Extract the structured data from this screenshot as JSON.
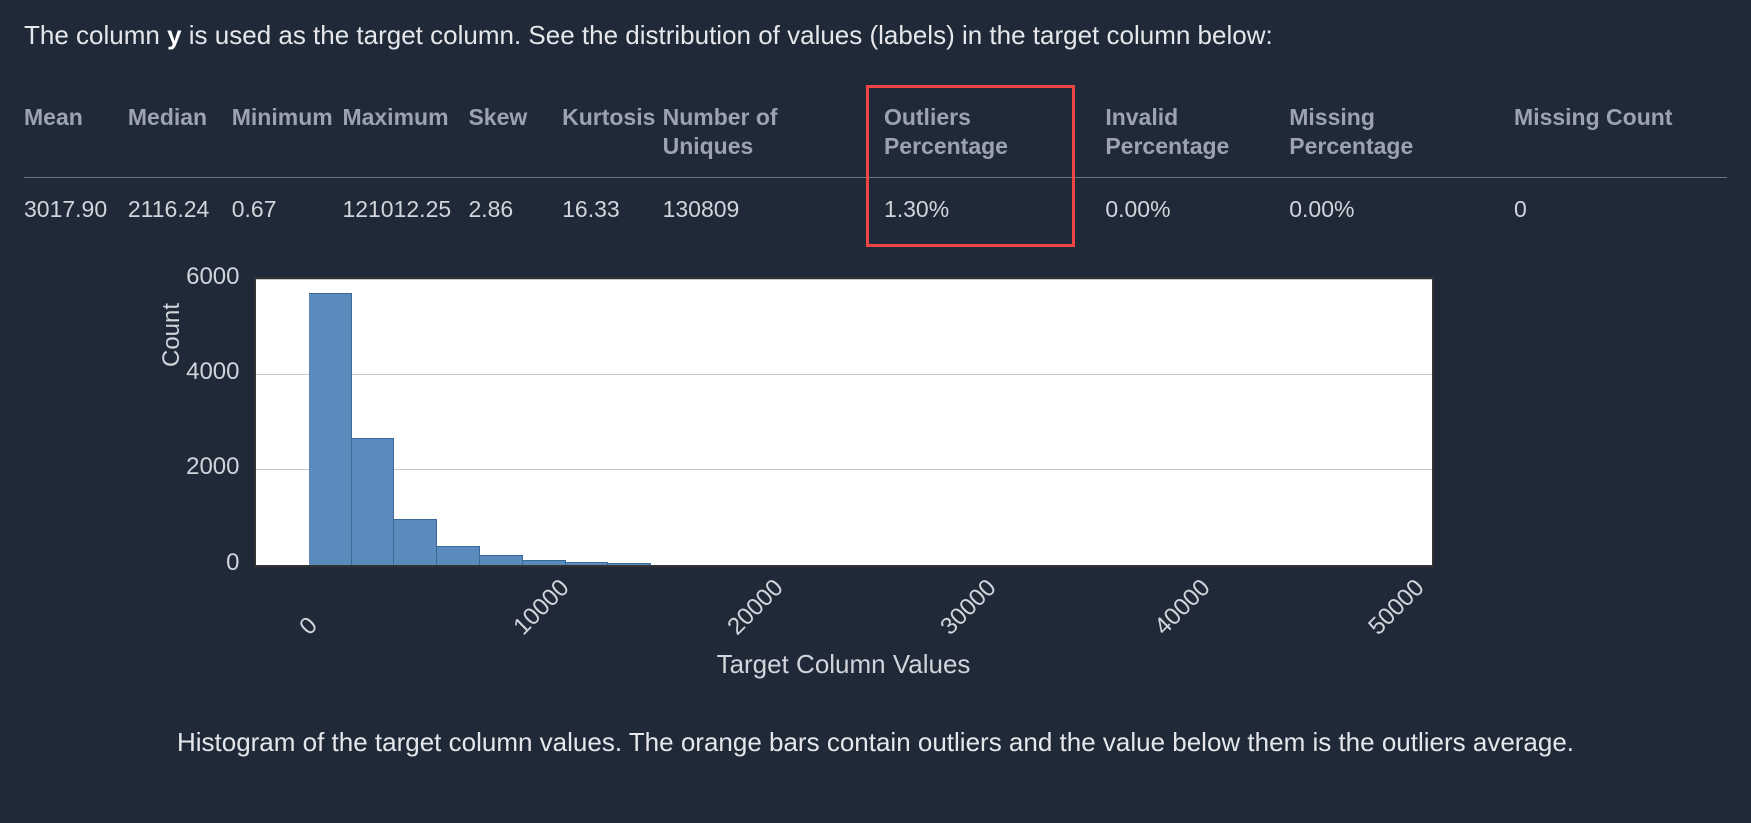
{
  "intro": {
    "prefix": "The column ",
    "column": "y",
    "suffix": " is used as the target column. See the distribution of values (labels) in the target column below:"
  },
  "stats": {
    "headers": {
      "mean": "Mean",
      "median": "Median",
      "minimum": "Minimum",
      "maximum": "Maximum",
      "skew": "Skew",
      "kurtosis": "Kurtosis",
      "uniques": "Number of Uniques",
      "outliers": "Outliers Percentage",
      "invalid": "Invalid Percentage",
      "missingp": "Missing Percentage",
      "missingc": "Missing Count"
    },
    "values": {
      "mean": "3017.90",
      "median": "2116.24",
      "minimum": "0.67",
      "maximum": "121012.25",
      "skew": "2.86",
      "kurtosis": "16.33",
      "uniques": "130809",
      "outliers": "1.30%",
      "invalid": "0.00%",
      "missingp": "0.00%",
      "missingc": "0"
    },
    "highlight_column": "outliers",
    "highlight_color": "#ef4444"
  },
  "caption": "Histogram of the target column values. The orange bars contain outliers and the value below them is the outliers average.",
  "chart_data": {
    "type": "bar",
    "title": "",
    "xlabel": "Target Column Values",
    "ylabel": "Count",
    "x_ticks": [
      0,
      10000,
      20000,
      30000,
      40000,
      50000
    ],
    "y_ticks": [
      0,
      2000,
      4000,
      6000
    ],
    "xlim": [
      -2500,
      52500
    ],
    "ylim": [
      0,
      6000
    ],
    "bin_width": 2000,
    "bin_starts": [
      0,
      2000,
      4000,
      6000,
      8000,
      10000,
      12000,
      14000
    ],
    "values": [
      5700,
      2650,
      950,
      400,
      200,
      100,
      60,
      30
    ],
    "bar_color": "#5b8bbd",
    "grid": true
  }
}
